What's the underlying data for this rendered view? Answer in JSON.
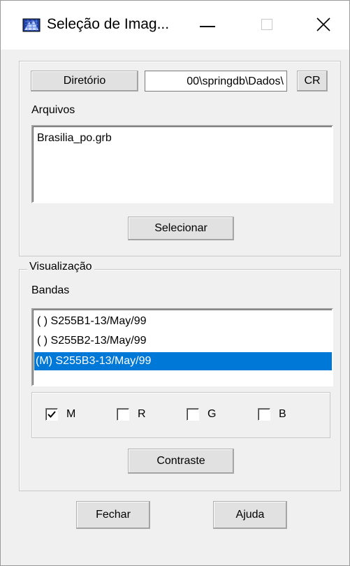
{
  "window": {
    "title": "Seleção de Imag...",
    "icon": "image-grid-icon",
    "controls": [
      "minimize-icon",
      "maximize-icon",
      "close-icon"
    ]
  },
  "selection": {
    "directory_button": "Diretório",
    "directory_path": "00\\springdb\\Dados\\",
    "cr_button": "CR",
    "files_label": "Arquivos",
    "files": [
      "Brasilia_po.grb"
    ],
    "select_button": "Selecionar"
  },
  "visualization": {
    "group_title": "Visualização",
    "bands_label": "Bandas",
    "bands": [
      {
        "label": "( ) S255B1-13/May/99",
        "selected": false
      },
      {
        "label": "( ) S255B2-13/May/99",
        "selected": false
      },
      {
        "label": "(M) S255B3-13/May/99",
        "selected": true
      }
    ],
    "channels": [
      {
        "label": "M",
        "checked": true
      },
      {
        "label": "R",
        "checked": false
      },
      {
        "label": "G",
        "checked": false
      },
      {
        "label": "B",
        "checked": false
      }
    ],
    "contrast_button": "Contraste"
  },
  "footer": {
    "close_button": "Fechar",
    "help_button": "Ajuda"
  },
  "colors": {
    "selection": "#0078d7",
    "dialog_bg": "#f0f0f0"
  }
}
